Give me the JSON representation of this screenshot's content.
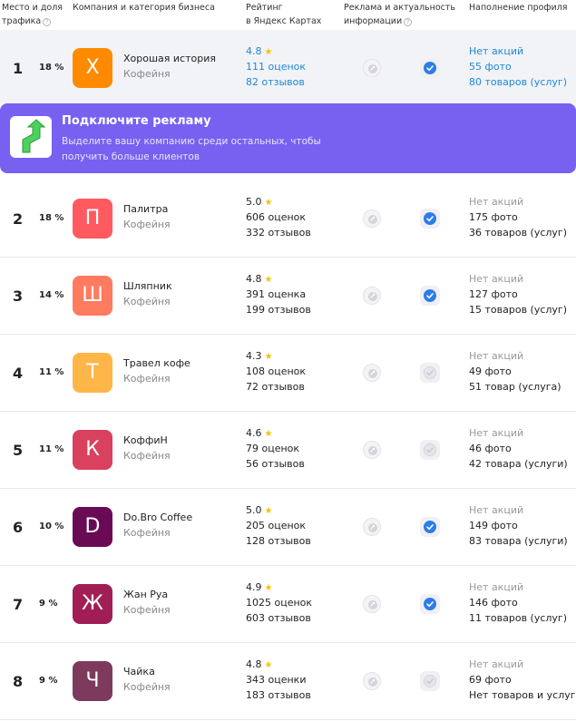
{
  "header": {
    "rank_line1": "Место и доля",
    "rank_line2": "трафика",
    "company": "Компания и категория бизнеса",
    "rating_line1": "Рейтинг",
    "rating_line2": "в Яндекс Картах",
    "ads_line1": "Реклама и актуальность",
    "ads_line2": "информации",
    "profile": "Наполнение профиля",
    "help_glyph": "?"
  },
  "promo": {
    "title": "Подключите рекламу",
    "text": "Выделите вашу компанию среди остальных, чтобы получить больше клиентов",
    "icon": "arrow-up-icon",
    "accent": "#7860f0"
  },
  "rows": [
    {
      "rank": "1",
      "share": "18 %",
      "letter": "Х",
      "color": "#ff8a00",
      "name": "Хорошая история",
      "category": "Кофейня",
      "rating": "4.8",
      "ratings": "111 оценок",
      "reviews": "82 отзывов",
      "promos": "Нет акций",
      "photos": "55 фото",
      "products": "80 товаров (услуг)",
      "actual": true
    },
    {
      "rank": "2",
      "share": "18 %",
      "letter": "П",
      "color": "#ff5a5f",
      "name": "Палитра",
      "category": "Кофейня",
      "rating": "5.0",
      "ratings": "606 оценок",
      "reviews": "332 отзывов",
      "promos": "Нет акций",
      "photos": "175 фото",
      "products": "36 товаров (услуг)",
      "actual": true
    },
    {
      "rank": "3",
      "share": "14 %",
      "letter": "Ш",
      "color": "#ff7b5f",
      "name": "Шляпник",
      "category": "Кофейня",
      "rating": "4.8",
      "ratings": "391 оценка",
      "reviews": "199 отзывов",
      "promos": "Нет акций",
      "photos": "127 фото",
      "products": "15 товаров (услуг)",
      "actual": true
    },
    {
      "rank": "4",
      "share": "11 %",
      "letter": "Т",
      "color": "#ffb648",
      "name": "Травел кофе",
      "category": "Кофейня",
      "rating": "4.3",
      "ratings": "108 оценок",
      "reviews": "72 отзывов",
      "promos": "Нет акций",
      "photos": "49 фото",
      "products": "51 товар (услуга)",
      "actual": false
    },
    {
      "rank": "5",
      "share": "11 %",
      "letter": "К",
      "color": "#d9415e",
      "name": "КоффиН",
      "category": "Кофейня",
      "rating": "4.6",
      "ratings": "79 оценок",
      "reviews": "56 отзывов",
      "promos": "Нет акций",
      "photos": "46 фото",
      "products": "42 товара (услуги)",
      "actual": false
    },
    {
      "rank": "6",
      "share": "10 %",
      "letter": "D",
      "color": "#6a0a55",
      "name": "Do.Bro Coffee",
      "category": "Кофейня",
      "rating": "5.0",
      "ratings": "205 оценок",
      "reviews": "128 отзывов",
      "promos": "Нет акций",
      "photos": "149 фото",
      "products": "83 товара (услуги)",
      "actual": true
    },
    {
      "rank": "7",
      "share": "9 %",
      "letter": "Ж",
      "color": "#a01e55",
      "name": "Жан Руа",
      "category": "Кофейня",
      "rating": "4.9",
      "ratings": "1025 оценок",
      "reviews": "603 отзывов",
      "promos": "Нет акций",
      "photos": "146 фото",
      "products": "11 товаров (услуг)",
      "actual": true
    },
    {
      "rank": "8",
      "share": "9 %",
      "letter": "Ч",
      "color": "#7e3a5c",
      "name": "Чайка",
      "category": "Кофейня",
      "rating": "4.8",
      "ratings": "343 оценки",
      "reviews": "183 отзывов",
      "promos": "Нет акций",
      "photos": "69 фото",
      "products": "Нет товаров и услуг",
      "actual": false
    }
  ]
}
